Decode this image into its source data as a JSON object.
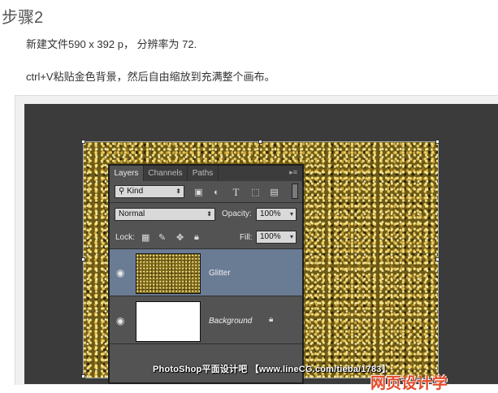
{
  "article": {
    "step_title": "步骤2",
    "line1": "新建文件590 x 392 p， 分辨率为 72.",
    "line2": "ctrl+V粘贴金色背景，然后自由缩放到充满整个画布。"
  },
  "layers_panel": {
    "tabs": [
      {
        "label": "Layers",
        "active": true
      },
      {
        "label": "Channels",
        "active": false
      },
      {
        "label": "Paths",
        "active": false
      }
    ],
    "filter_kind": "Kind",
    "filter_icons": [
      "image-filter-icon",
      "adjustment-filter-icon",
      "type-filter-icon",
      "shape-filter-icon",
      "smart-object-filter-icon"
    ],
    "blend_mode": "Normal",
    "opacity_label": "Opacity:",
    "opacity_value": "100%",
    "lock_label": "Lock:",
    "lock_icons": [
      "lock-transparent-icon",
      "lock-paint-icon",
      "lock-position-icon",
      "lock-all-icon"
    ],
    "fill_label": "Fill:",
    "fill_value": "100%",
    "layers": [
      {
        "name": "Glitter",
        "selected": true,
        "locked": false,
        "visible": true
      },
      {
        "name": "Background",
        "selected": false,
        "locked": true,
        "visible": true
      }
    ]
  },
  "watermark": {
    "text": "PhotoShop平面设计吧 【www.lineCG.com/tieba/1783】",
    "logo": "网页设计学"
  },
  "colors": {
    "workspace": "#3b3b3b",
    "panel": "#535353",
    "selected_layer": "#6a7b94",
    "glitter": "#6d5a14"
  }
}
